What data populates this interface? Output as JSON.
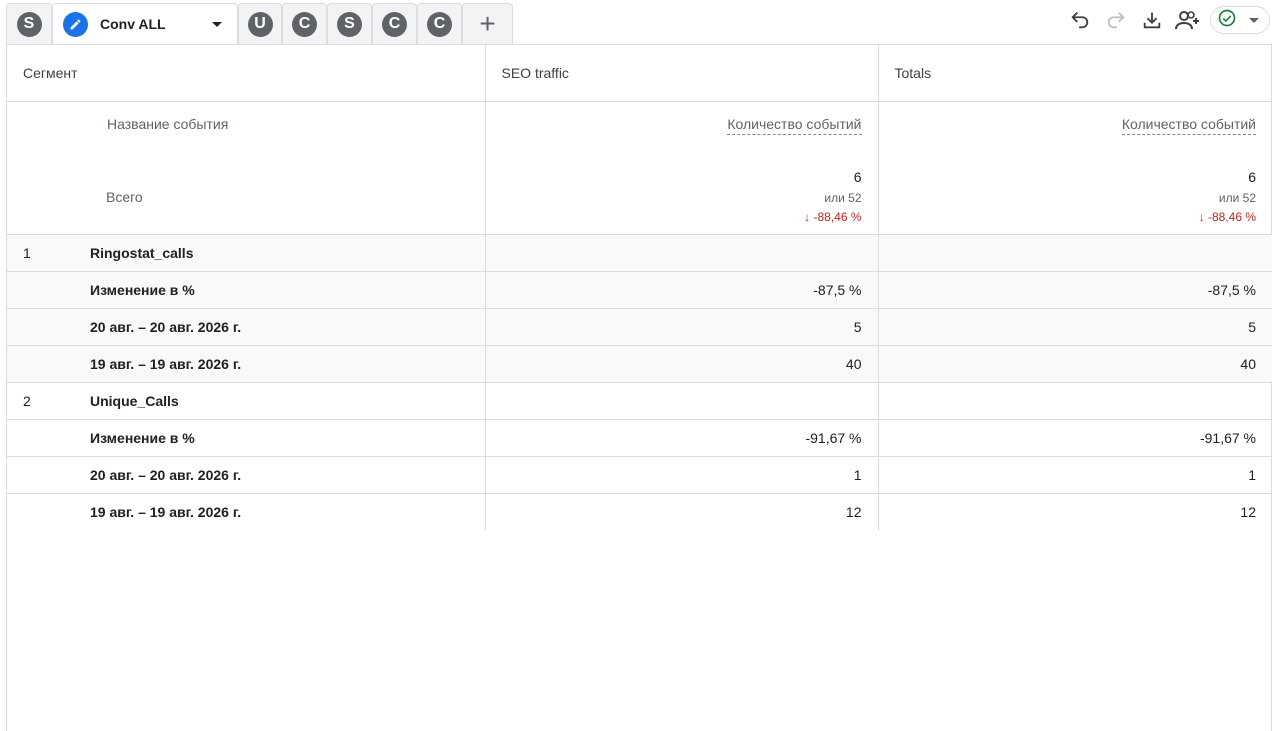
{
  "tabs": [
    {
      "letter": "S"
    },
    {
      "name": "Conv ALL"
    },
    {
      "letter": "U"
    },
    {
      "letter": "C"
    },
    {
      "letter": "S"
    },
    {
      "letter": "C"
    },
    {
      "letter": "C"
    }
  ],
  "add_tab_label": "+",
  "toolbar": {
    "icons": [
      "undo-icon",
      "redo-icon",
      "download-icon",
      "share-user-icon",
      "check-circle-icon"
    ],
    "status_color": "#188038"
  },
  "table": {
    "headers": {
      "segment": "Сегмент",
      "col1": "SEO traffic",
      "col2": "Totals"
    },
    "dimension_label": "Название события",
    "total_label": "Всего",
    "metric_name": "Количество событий",
    "totals": [
      {
        "value": "6",
        "sub": "или 52",
        "delta": "-88,46 %"
      },
      {
        "value": "6",
        "sub": "или 52",
        "delta": "-88,46 %"
      }
    ],
    "groups": [
      {
        "index": "1",
        "name": "Ringostat_calls",
        "rows": [
          {
            "label": "Изменение в %",
            "v1": "-87,5 %",
            "v2": "-87,5 %"
          },
          {
            "label": "20 авг. – 20 авг. 2026 г.",
            "v1": "5",
            "v2": "5"
          },
          {
            "label": "19 авг. – 19 авг. 2026 г.",
            "v1": "40",
            "v2": "40"
          }
        ]
      },
      {
        "index": "2",
        "name": "Unique_Calls",
        "rows": [
          {
            "label": "Изменение в %",
            "v1": "-91,67 %",
            "v2": "-91,67 %"
          },
          {
            "label": "20 авг. – 20 авг. 2026 г.",
            "v1": "1",
            "v2": "1"
          },
          {
            "label": "19 авг. – 19 авг. 2026 г.",
            "v1": "12",
            "v2": "12"
          }
        ]
      }
    ]
  },
  "colors": {
    "negative": "#c5221f",
    "accent": "#1a73e8"
  }
}
